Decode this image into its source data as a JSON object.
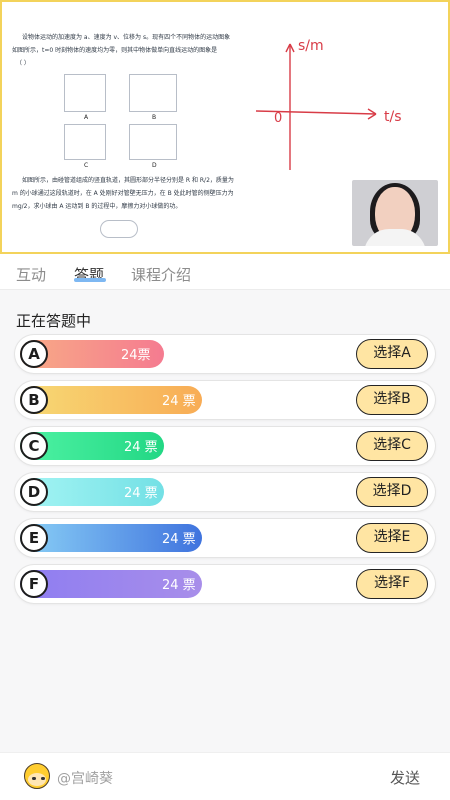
{
  "board": {
    "question_text_1": "设物体运动的加速度为 a、速度为 v、位移为 s。现有四个不同物体的运动图象",
    "question_text_2": "如图所示，t=0 时刻物体的速度均为零，则其中物体做单向直线运动的图象是",
    "question_text_3": "（    ）",
    "question_text_4": "如图所示，由碰管道组成的竖直轨道，其圆形部分半径分别是 R 和 R/2，质量为",
    "question_text_5": "m 的小球通过这段轨道时，在 A 处刚好对管壁无压力，在 B 处此时管的侧壁压力为",
    "question_text_6": "mg/2，求小球由 A 运动到 B 的过程中，摩擦力对小球做的功。",
    "handwritten_y": "s/m",
    "handwritten_x": "t/s",
    "handwritten_origin": "0"
  },
  "tabs": [
    {
      "label": "互动"
    },
    {
      "label": "答题"
    },
    {
      "label": "课程介绍"
    }
  ],
  "status": "正在答题中",
  "options": [
    {
      "letter": "A",
      "votes": "24票",
      "button": "选择A",
      "fill": 0.43
    },
    {
      "letter": "B",
      "votes": "24 票",
      "button": "选择B",
      "fill": 0.54
    },
    {
      "letter": "C",
      "votes": "24 票",
      "button": "选择C",
      "fill": 0.43
    },
    {
      "letter": "D",
      "votes": "24 票",
      "button": "选择D",
      "fill": 0.43
    },
    {
      "letter": "E",
      "votes": "24 票",
      "button": "选择E",
      "fill": 0.54
    },
    {
      "letter": "F",
      "votes": "24 票",
      "button": "选择F",
      "fill": 0.54
    }
  ],
  "chat": {
    "placeholder": "@宫崎葵",
    "send": "发送"
  },
  "icons": {
    "avatar": "smiling-user-icon"
  }
}
